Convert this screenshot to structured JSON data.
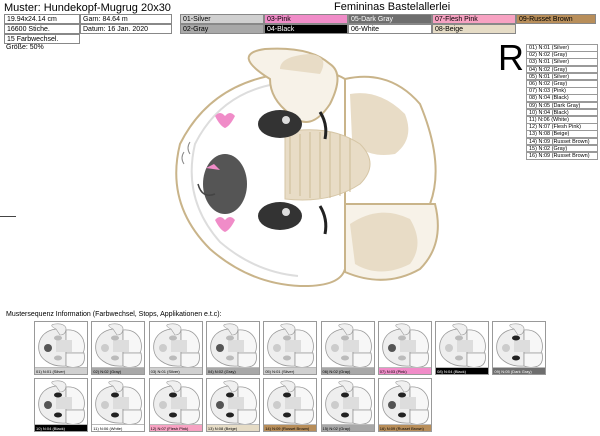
{
  "header": {
    "title": "Muster: Hundekopf-Mugrug 20x30",
    "brand": "Femininas Bastelallerlei",
    "size": "19.94x24.14 cm",
    "thread": "Garn: 84.64 m",
    "stitches": "16600 Stiche.",
    "date": "Datum: 16 Jan. 2020",
    "colorchanges": "15 Farbwechsel."
  },
  "colors": [
    {
      "label": "01-Silver",
      "bg": "#d0d0d0",
      "fg": "#000"
    },
    {
      "label": "03-Pink",
      "bg": "#f08cc8",
      "fg": "#000"
    },
    {
      "label": "05-Dark Gray",
      "bg": "#6e6e6e",
      "fg": "#fff"
    },
    {
      "label": "07-Flesh Pink",
      "bg": "#f7a2c2",
      "fg": "#000"
    },
    {
      "label": "09-Russet Brown",
      "bg": "#b88e5a",
      "fg": "#000"
    },
    {
      "label": "02-Gray",
      "bg": "#a8a8a8",
      "fg": "#000"
    },
    {
      "label": "04-Black",
      "bg": "#000000",
      "fg": "#fff"
    },
    {
      "label": "06-White",
      "bg": "#ffffff",
      "fg": "#000"
    },
    {
      "label": "08-Beige",
      "bg": "#e6dcc6",
      "fg": "#000"
    }
  ],
  "size_label": "Größe: 50%",
  "letter": "R",
  "sequence": [
    "01) N:01 (Silver)",
    "02) N:02 (Gray)",
    "03) N:01 (Silver)",
    "04) N:02 (Gray)",
    "05) N:01 (Silver)",
    "06) N:02 (Gray)",
    "07) N:03 (Pink)",
    "08) N:04 (Black)",
    "09) N:05 (Dark Gray)",
    "10) N:04 (Black)",
    "11) N:06 (White)",
    "12) N:07 (Flesh Pink)",
    "13) N:08 (Beige)",
    "14) N:09 (Russet Brown)",
    "15) N:02 (Gray)",
    "16) N:09 (Russet Brown)"
  ],
  "seq_info": "Mustersequenz Information (Farbwechsel, Stops, Applikationen e.t.c):",
  "thumbs": [
    {
      "label": "01) N:01 (Silver)",
      "color": "#d0d0d0",
      "fg": "#000"
    },
    {
      "label": "02) N:02 (Gray)",
      "color": "#a8a8a8",
      "fg": "#000"
    },
    {
      "label": "03) N:01 (Silver)",
      "color": "#d0d0d0",
      "fg": "#000"
    },
    {
      "label": "04) N:02 (Gray)",
      "color": "#a8a8a8",
      "fg": "#000"
    },
    {
      "label": "05) N:01 (Silver)",
      "color": "#d0d0d0",
      "fg": "#000"
    },
    {
      "label": "06) N:02 (Gray)",
      "color": "#a8a8a8",
      "fg": "#000"
    },
    {
      "label": "07) N:03 (Pink)",
      "color": "#f08cc8",
      "fg": "#000"
    },
    {
      "label": "08) N:04 (Black)",
      "color": "#000000",
      "fg": "#fff"
    },
    {
      "label": "09) N:05 (Dark Gray)",
      "color": "#6e6e6e",
      "fg": "#fff"
    },
    {
      "label": "10) N:04 (Black)",
      "color": "#000000",
      "fg": "#fff"
    },
    {
      "label": "11) N:06 (White)",
      "color": "#ffffff",
      "fg": "#000"
    },
    {
      "label": "12) N:07 (Flesh Pink)",
      "color": "#f7a2c2",
      "fg": "#000"
    },
    {
      "label": "13) N:08 (Beige)",
      "color": "#e6dcc6",
      "fg": "#000"
    },
    {
      "label": "14) N:09 (Russet Brown)",
      "color": "#b88e5a",
      "fg": "#000"
    },
    {
      "label": "15) N:02 (Gray)",
      "color": "#a8a8a8",
      "fg": "#000"
    },
    {
      "label": "16) N:09 (Russet Brown)",
      "color": "#b88e5a",
      "fg": "#000"
    }
  ]
}
